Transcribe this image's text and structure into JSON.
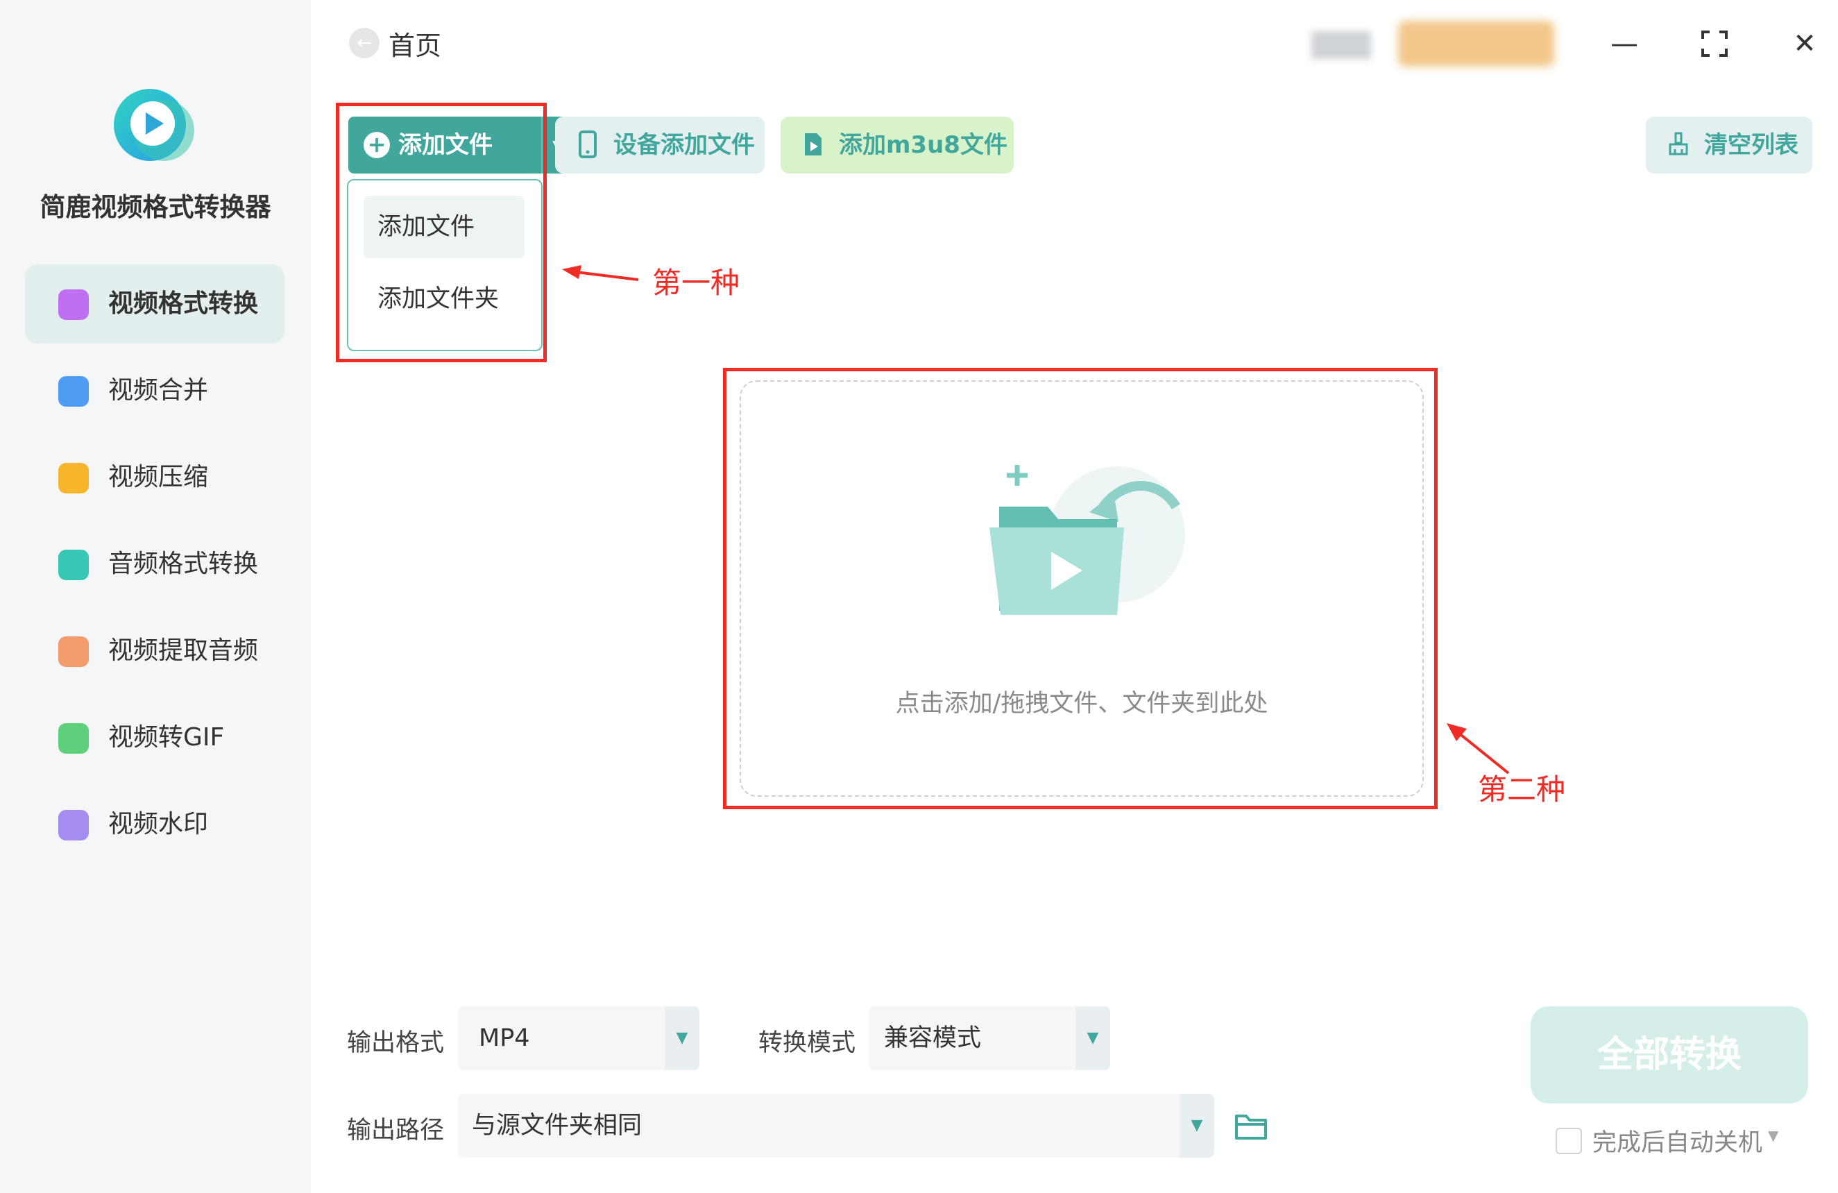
{
  "app": {
    "name": "简鹿视频格式转换器"
  },
  "sidebar": {
    "items": [
      {
        "label": "视频格式转换",
        "icon": "video-convert-icon",
        "color": "#c16ff2",
        "active": true
      },
      {
        "label": "视频合并",
        "icon": "video-merge-icon",
        "color": "#4f9cf5"
      },
      {
        "label": "视频压缩",
        "icon": "video-compress-icon",
        "color": "#f7b52b"
      },
      {
        "label": "音频格式转换",
        "icon": "audio-convert-icon",
        "color": "#39c7b5"
      },
      {
        "label": "视频提取音频",
        "icon": "extract-audio-icon",
        "color": "#f49b6b"
      },
      {
        "label": "视频转GIF",
        "icon": "gif-icon",
        "color": "#5ecf7a"
      },
      {
        "label": "视频水印",
        "icon": "watermark-icon",
        "color": "#a58cf0"
      }
    ]
  },
  "header": {
    "breadcrumb": "首页"
  },
  "toolbar": {
    "add_file": "添加文件",
    "device_add": "设备添加文件",
    "add_m3u8": "添加m3u8文件",
    "clear_list": "清空列表"
  },
  "dropdown_menu": {
    "items": [
      "添加文件",
      "添加文件夹"
    ]
  },
  "annotations": {
    "first": "第一种",
    "second": "第二种"
  },
  "dropzone": {
    "hint": "点击添加/拖拽文件、文件夹到此处"
  },
  "output": {
    "format_label": "输出格式",
    "format_value": "MP4",
    "mode_label": "转换模式",
    "mode_value": "兼容模式",
    "path_label": "输出路径",
    "path_value": "与源文件夹相同"
  },
  "actions": {
    "convert_all": "全部转换",
    "auto_shutdown": "完成后自动关机"
  },
  "colors": {
    "accent": "#41a79c",
    "annotation_red": "#ee2b24",
    "sidebar_bg": "#f5f6f7"
  }
}
